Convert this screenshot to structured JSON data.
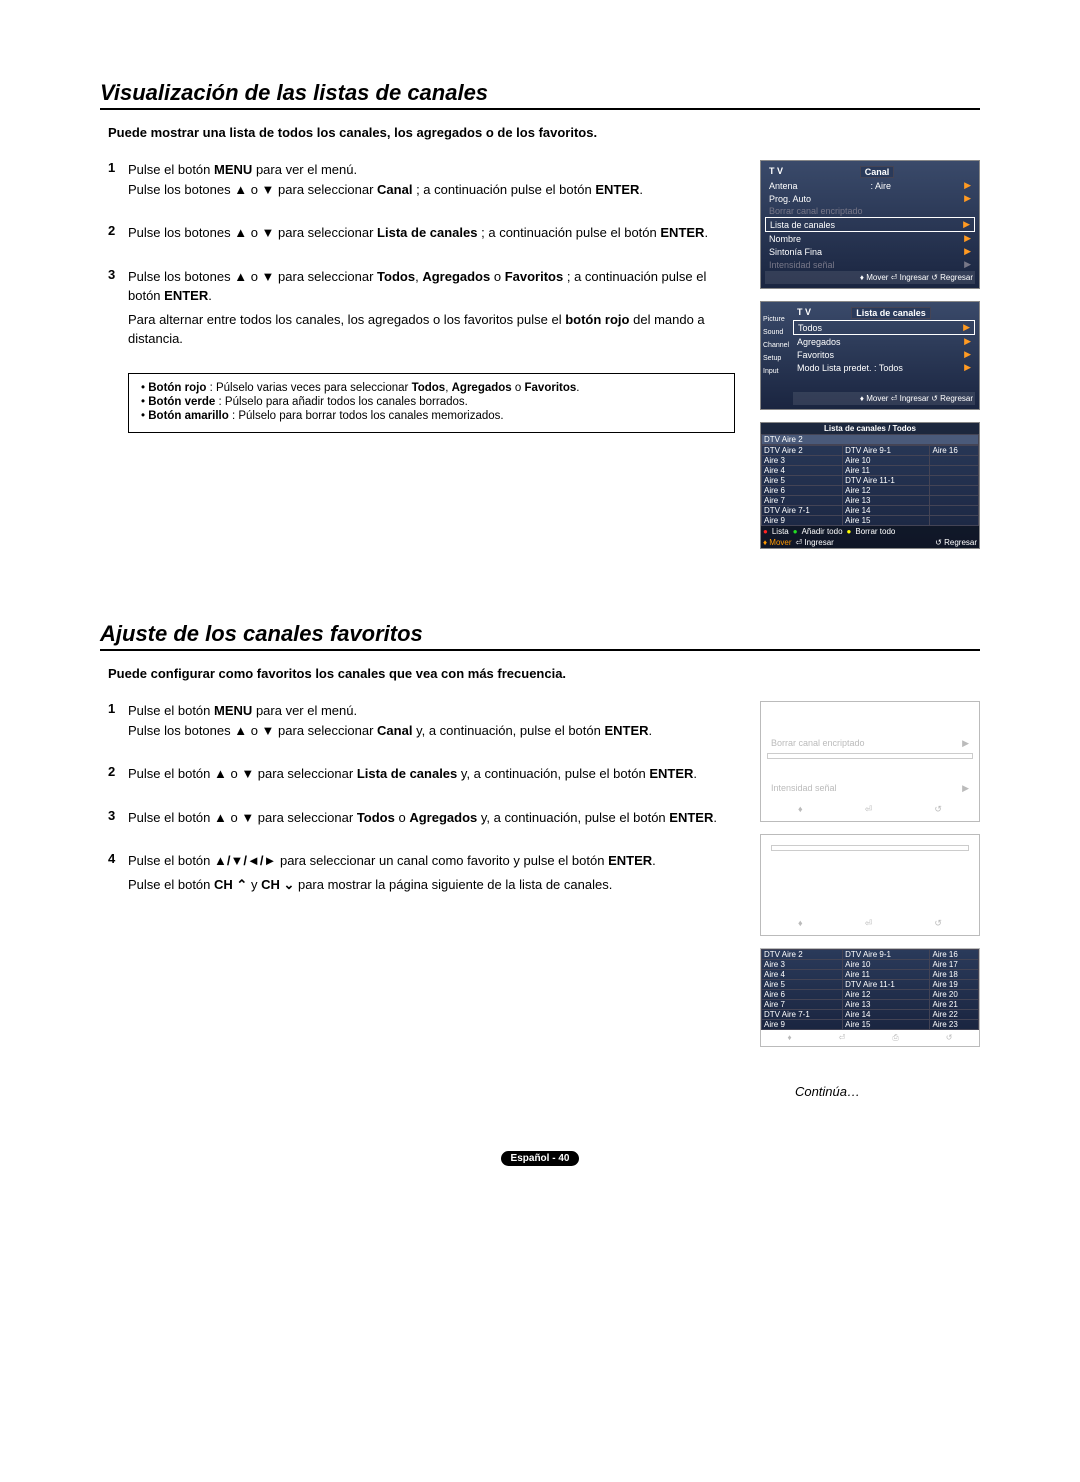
{
  "s1": {
    "title": "Visualización de las listas de canales",
    "intro": "Puede mostrar una lista de todos los canales, los agregados o de los favoritos.",
    "steps": [
      {
        "n": "1",
        "l1": "Pulse el botón",
        "b1": "MENU",
        "l2": "para ver el menú.",
        "l3": "Pulse los botones ▲ o ▼ para seleccionar",
        "b2": "Canal",
        "l4": "; a continuación pulse el botón",
        "b3": "ENTER",
        "l5": "."
      },
      {
        "n": "2",
        "l1": "Pulse los botones ▲ o ▼ para seleccionar",
        "b1": "Lista de canales",
        "l2": "; a continuación pulse el botón",
        "b2": "ENTER",
        "l3": "."
      },
      {
        "n": "3",
        "l1": "Pulse los botones ▲ o ▼ para seleccionar",
        "b1": "Todos",
        "c1": ",",
        "b2": "Agregados",
        "c2": "o",
        "b3": "Favoritos",
        "l2": "; a continuación pulse el botón",
        "b4": "ENTER",
        "l3": ".",
        "p2a": "Para alternar entre todos los canales, los agregados o los favoritos pulse el",
        "p2b": "botón rojo",
        "p2c": "del mando a distancia."
      }
    ],
    "notes": [
      {
        "b": "Botón rojo",
        "t": ": Púlselo varias veces para seleccionar",
        "b2": "Todos",
        "c": ",",
        "b3": "Agregados",
        "c2": "o",
        "b4": "Favoritos",
        "t2": "."
      },
      {
        "b": "Botón verde",
        "t": ": Púlselo para añadir todos los canales borrados."
      },
      {
        "b": "Botón amarillo",
        "t": ": Púlselo para borrar todos los canales memorizados."
      }
    ]
  },
  "s2": {
    "title": "Ajuste de los canales favoritos",
    "intro": "Puede configurar como favoritos los canales que vea con más frecuencia.",
    "steps": [
      {
        "n": "1",
        "l1": "Pulse el botón",
        "b1": "MENU",
        "l2": "para ver el menú.",
        "l3": "Pulse los botones ▲ o ▼ para seleccionar",
        "b2": "Canal",
        "l4": "y, a continuación, pulse el botón",
        "b3": "ENTER",
        "l5": "."
      },
      {
        "n": "2",
        "l1": "Pulse el botón ▲ o ▼ para seleccionar",
        "b1": "Lista de canales",
        "l2": "y, a continuación, pulse el botón",
        "b2": "ENTER",
        "l3": "."
      },
      {
        "n": "3",
        "l1": "Pulse el botón ▲ o ▼ para seleccionar",
        "b1": "Todos",
        "c1": "o",
        "b2": "Agregados",
        "l2": "y, a continuación, pulse el botón",
        "b3": "ENTER",
        "l3": "."
      },
      {
        "n": "4",
        "l1": "Pulse el botón",
        "b1": "▲/▼/◄/►",
        "l2": "para seleccionar un canal como favorito y pulse el botón",
        "b2": "ENTER",
        "l3": ".",
        "p2a": "Pulse el botón",
        "p2b": "CH ⌃",
        "p2c": "y",
        "p2d": "CH ⌄",
        "p2e": "para mostrar la página siguiente de la lista de canales."
      }
    ]
  },
  "osd1": {
    "tv": "T V",
    "title": "Canal",
    "r1a": "Antena",
    "r1b": ": Aire",
    "r2": "Prog. Auto",
    "r3": "Borrar canal encriptado",
    "r4": "Lista de canales",
    "r5": "Nombre",
    "r6": "Sintonía Fina",
    "r7": "Intensidad señal",
    "f": "♦ Mover  ⏎ Ingresar  ↺ Regresar"
  },
  "osd2": {
    "tv": "T V",
    "title": "Lista de canales",
    "i1": "Picture",
    "i2": "Sound",
    "i3": "Channel",
    "i4": "Setup",
    "i5": "Input",
    "r1": "Todos",
    "r2": "Agregados",
    "r3": "Favoritos",
    "r4": "Modo Lista predet. : Todos",
    "f": "♦ Mover  ⏎ Ingresar  ↺ Regresar"
  },
  "osd3": {
    "title": "Lista de canales / Todos",
    "hl": "DTV Aire 2",
    "c0": [
      "DTV Aire 2",
      "Aire 3",
      "Aire 4",
      "Aire 5",
      "Aire 6",
      "Aire 7",
      "DTV Aire 7-1",
      "Aire 9"
    ],
    "c1": [
      "DTV Aire 9-1",
      "Aire 10",
      "Aire 11",
      "DTV Aire 11-1",
      "Aire 12",
      "Aire 13",
      "Aire 14",
      "Aire 15"
    ],
    "c2": [
      "Aire 16",
      "",
      "",
      "",
      "",
      "",
      "",
      ""
    ],
    "f1": "Lista",
    "f2": "Añadir todo",
    "f3": "Borrar todo",
    "fm": "♦ Mover",
    "fi": "⏎ Ingresar",
    "fr": "↺ Regresar"
  },
  "g1": {
    "r1": "Borrar canal encriptado",
    "r2": "Intensidad señal"
  },
  "osd4": {
    "c0": [
      "DTV Aire 2",
      "Aire 3",
      "Aire 4",
      "Aire 5",
      "Aire 6",
      "Aire 7",
      "DTV Aire 7-1",
      "Aire 9"
    ],
    "c1": [
      "DTV Aire 9-1",
      "Aire 10",
      "Aire 11",
      "DTV Aire 11-1",
      "Aire 12",
      "Aire 13",
      "Aire 14",
      "Aire 15"
    ],
    "c2": [
      "Aire 16",
      "Aire 17",
      "Aire 18",
      "Aire 19",
      "Aire 20",
      "Aire 21",
      "Aire 22",
      "Aire 23"
    ]
  },
  "cont": "Continúa…",
  "page": "Español - 40"
}
